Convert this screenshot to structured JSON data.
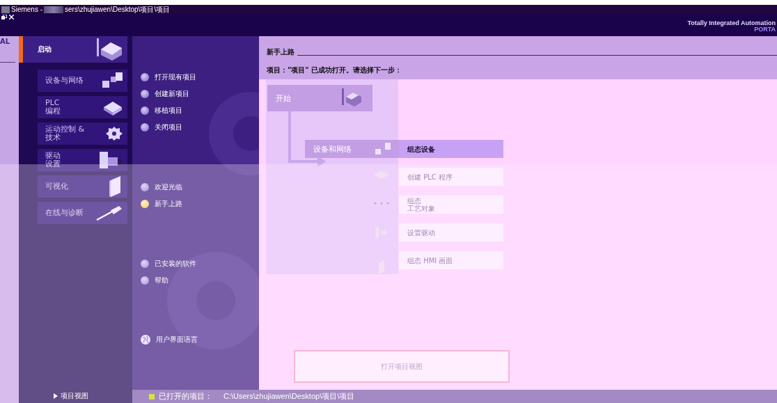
{
  "window": {
    "title_prefix": "Siemens  - ",
    "title_path": "sers\\zhujiawen\\Desktop\\项目\\项目"
  },
  "brand": {
    "line1": "Totally Integrated Automation",
    "line2": "PORTA"
  },
  "edge_label": "AL",
  "nav": {
    "items": [
      {
        "lines": [
          "启动"
        ],
        "kind": "main",
        "selected": true
      },
      {
        "lines": [
          "设备与网络"
        ],
        "kind": "sub",
        "selected": false
      },
      {
        "lines": [
          "PLC",
          "编程"
        ],
        "kind": "sub",
        "selected": false
      },
      {
        "lines": [
          "运动控制 &",
          "技术"
        ],
        "kind": "sub",
        "selected": false
      },
      {
        "lines": [
          "驱动",
          "设置"
        ],
        "kind": "sub",
        "selected": false
      },
      {
        "lines": [
          "可视化"
        ],
        "kind": "sub",
        "selected": false
      },
      {
        "lines": [
          "在线与诊断"
        ],
        "kind": "sub",
        "selected": false
      }
    ],
    "footer": "项目视图"
  },
  "actions": {
    "groups": [
      [
        {
          "label": "打开现有项目",
          "kind": "bullet",
          "selected": false
        },
        {
          "label": "创建新项目",
          "kind": "bullet",
          "selected": false
        },
        {
          "label": "移植项目",
          "kind": "bullet",
          "selected": false
        },
        {
          "label": "关闭项目",
          "kind": "bullet",
          "selected": false
        }
      ],
      [
        {
          "label": "欢迎光临",
          "kind": "bullet",
          "selected": false
        },
        {
          "label": "新手上路",
          "kind": "bullet",
          "selected": true
        }
      ],
      [
        {
          "label": "已安装的软件",
          "kind": "bullet",
          "selected": false
        },
        {
          "label": "帮助",
          "kind": "bullet",
          "selected": false
        }
      ],
      [
        {
          "label": "用户界面语言",
          "kind": "globe",
          "selected": false
        }
      ]
    ]
  },
  "content": {
    "heading": "新手上路",
    "message": "项目：\"项目\" 已成功打开。请选择下一步：",
    "start": "开始",
    "step": "设备和网络",
    "options": [
      {
        "lines": [
          "组态设备"
        ],
        "selected": true
      },
      {
        "lines": [
          "创建 PLC 程序"
        ],
        "selected": false
      },
      {
        "lines": [
          "组态",
          "工艺对象"
        ],
        "selected": false
      },
      {
        "lines": [
          "设置驱动"
        ],
        "selected": false
      },
      {
        "lines": [
          "组态 HMI 画面"
        ],
        "selected": false
      }
    ],
    "open_view_button": "打开项目视图"
  },
  "status_bar": {
    "label": "已打开的项目：",
    "path": "C:\\Users\\zhujiawen\\Desktop\\项目\\项目"
  }
}
